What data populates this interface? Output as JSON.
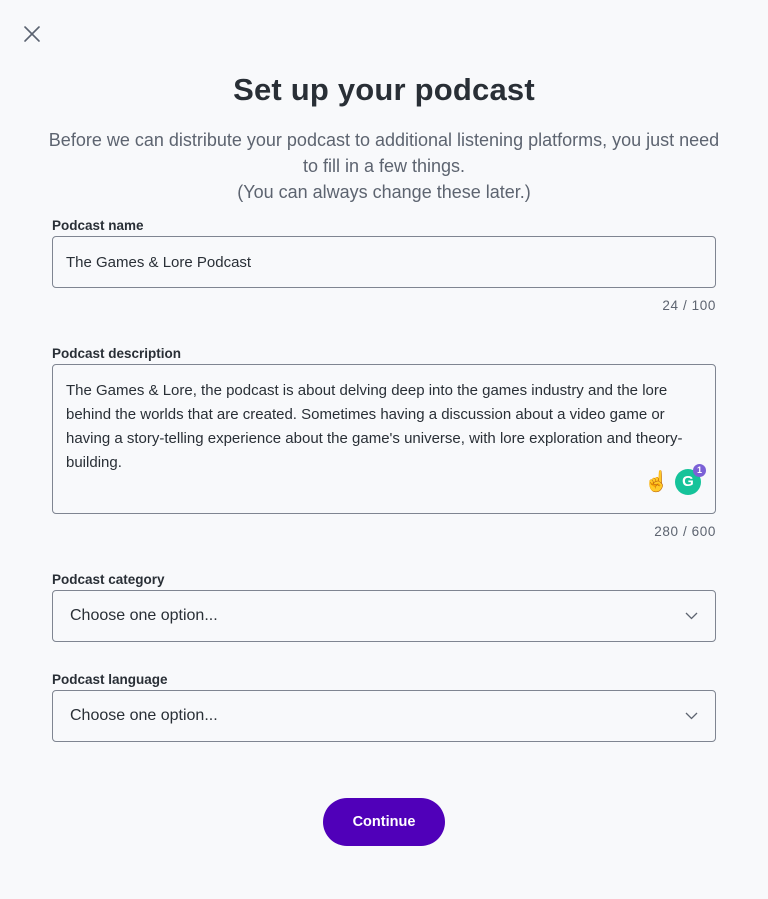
{
  "header": {
    "close_icon": "close-icon",
    "title": "Set up your podcast",
    "subtitle_line1": "Before we can distribute your podcast to additional listening platforms, you just need to fill in a few things.",
    "subtitle_line2": "(You can always change these later.)"
  },
  "form": {
    "name": {
      "label": "Podcast name",
      "value": "The Games & Lore Podcast",
      "counter": "24 / 100"
    },
    "description": {
      "label": "Podcast description",
      "value": "The Games & Lore, the podcast is about delving deep into the games industry and the lore behind the worlds that are created. Sometimes having a discussion about a video game or having a story-telling experience about the game's universe, with lore exploration and theory-building.",
      "counter": "280 / 600",
      "grammarly_letter": "G",
      "grammarly_badge": "1"
    },
    "category": {
      "label": "Podcast category",
      "placeholder": "Choose one option..."
    },
    "language": {
      "label": "Podcast language",
      "placeholder": "Choose one option..."
    }
  },
  "actions": {
    "continue_label": "Continue"
  },
  "colors": {
    "accent": "#5000b9",
    "background": "#f8f9fb",
    "text": "#292f36",
    "muted": "#5d6470",
    "grammarly": "#15c39a"
  }
}
